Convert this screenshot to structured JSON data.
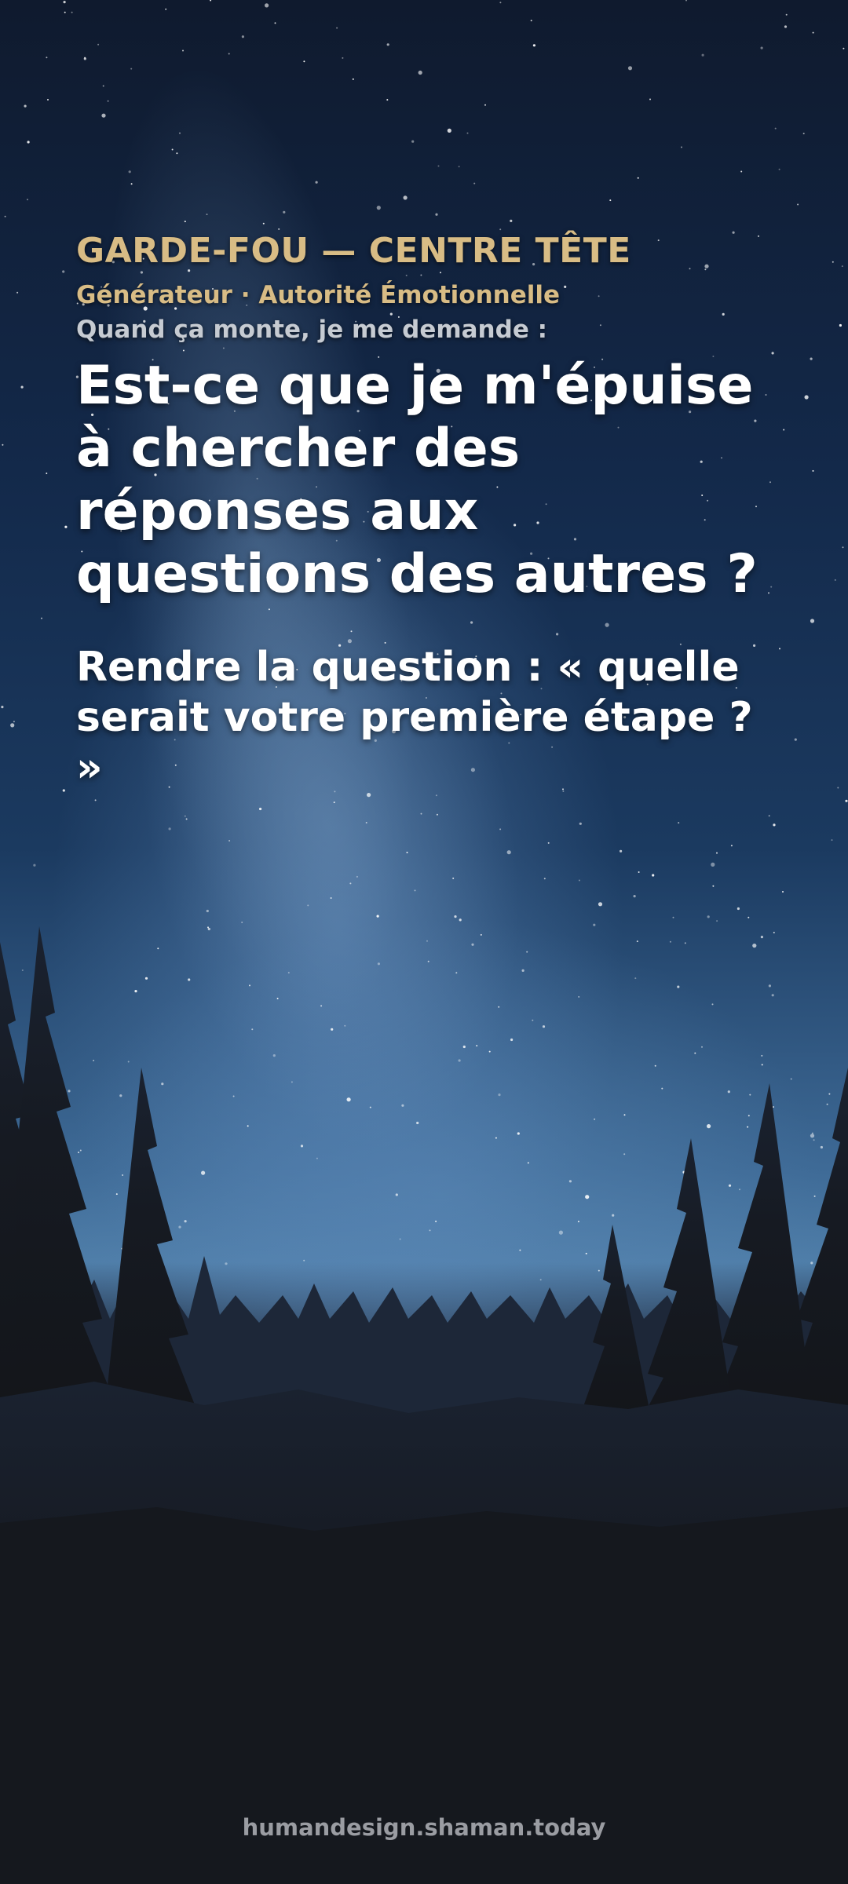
{
  "card": {
    "eyebrow": "GARDE-FOU — CENTRE TÊTE",
    "subtitle": "Générateur · Autorité Émotionnelle",
    "prompt": "Quand ça monte, je me demande :",
    "question": "Est-ce que je m'épuise à chercher des réponses aux questions des autres ?",
    "answer": "Rendre la question : « quelle serait votre première étape ? »"
  },
  "footer": {
    "site": "humandesign.shaman.today"
  },
  "background": {
    "scene": "starry-night-forest",
    "colors": {
      "accent": "#d8bc85",
      "text": "#ffffff",
      "muted": "#c6cbd2",
      "footer": "#9a9ca2"
    }
  }
}
